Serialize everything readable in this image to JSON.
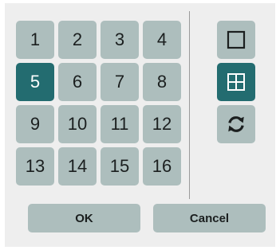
{
  "grid": {
    "cells": [
      "1",
      "2",
      "3",
      "4",
      "5",
      "6",
      "7",
      "8",
      "9",
      "10",
      "11",
      "12",
      "13",
      "14",
      "15",
      "16"
    ],
    "selected": "5"
  },
  "tools": [
    {
      "icon": "single-view-icon",
      "selected": false
    },
    {
      "icon": "grid-view-icon",
      "selected": true
    },
    {
      "icon": "refresh-icon",
      "selected": false
    }
  ],
  "buttons": {
    "ok_label": "OK",
    "cancel_label": "Cancel"
  },
  "colors": {
    "cell": "#adbebd",
    "selected": "#236c70",
    "background": "#eeeeee"
  }
}
